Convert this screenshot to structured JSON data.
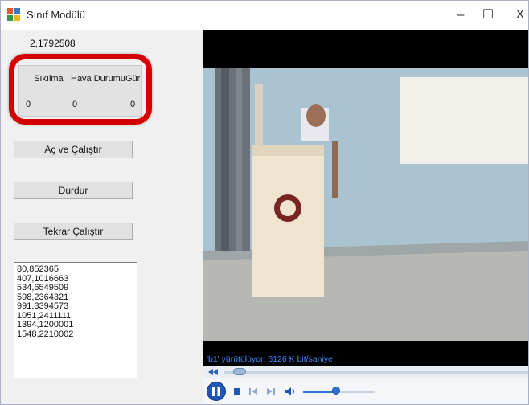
{
  "window": {
    "title": "Sınıf Modülü",
    "controls": [
      "–",
      "☐",
      "X"
    ],
    "icon": "app-window-icon"
  },
  "left_panel": {
    "top_value": "2,1792508",
    "table": {
      "headers": [
        "Sıkılma",
        "Hava Durumu",
        "Gür"
      ],
      "values": [
        "0",
        "0",
        "0"
      ]
    },
    "buttons": {
      "start": "Aç ve Çalıştır",
      "stop": "Durdur",
      "restart": "Tekrar Çalıştır"
    },
    "list_items": [
      "80,852365",
      "407,1016663",
      "534,6549509",
      "598,2364321",
      "991,3394573",
      "1051,2411111",
      "1394,1200001",
      "1548,2210002"
    ]
  },
  "player": {
    "status_text": "'b1' yürütülüyor: 6126 K bit/saniye",
    "volume_level": 0.45,
    "seek_position": 0.03
  },
  "colors": {
    "highlight": "#d40000",
    "player_accent": "#1f56b8",
    "status_text": "#3d8bff"
  }
}
